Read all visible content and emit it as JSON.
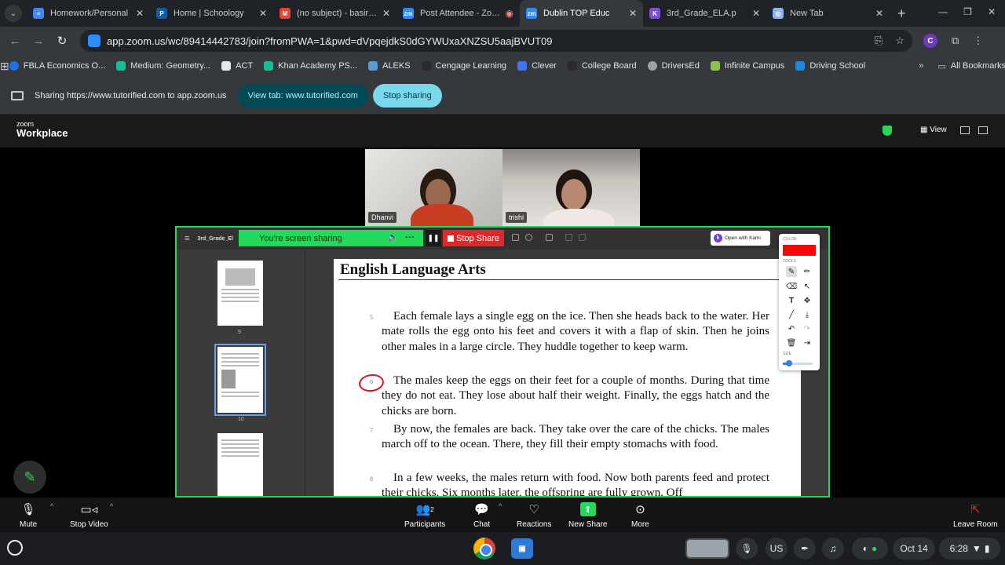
{
  "browser": {
    "tabs": [
      {
        "title": "Homework/Personal",
        "favicon_color": "#4285f4",
        "favicon_text": "≡"
      },
      {
        "title": "Home | Schoology",
        "favicon_color": "#0c5fa6",
        "favicon_text": "P"
      },
      {
        "title": "(no subject) - basired",
        "favicon_color": "#ea4335",
        "favicon_text": "M"
      },
      {
        "title": "Post Attendee - Zoom",
        "favicon_color": "#2d8cff",
        "favicon_text": "zm"
      },
      {
        "title": "Dublin TOP Educ",
        "favicon_color": "#2d8cff",
        "favicon_text": "zm",
        "active": true
      },
      {
        "title": "3rd_Grade_ELA.p",
        "favicon_color": "#7b4fd6",
        "favicon_text": "K"
      },
      {
        "title": "New Tab",
        "favicon_color": "#8ab4f8",
        "favicon_text": "◎"
      }
    ],
    "url": "app.zoom.us/wc/89414442783/join?fromPWA=1&pwd=dVpqejdkS0dGYWUxaXNZSU5aajBVUT09",
    "profile_initial": "C",
    "bookmarks": [
      {
        "label": "FBLA Economics O...",
        "color": "#1a73e8"
      },
      {
        "label": "Medium: Geometry...",
        "color": "#14bf96"
      },
      {
        "label": "ACT",
        "color": "#e8e8e8"
      },
      {
        "label": "Khan Academy PS...",
        "color": "#14bf96"
      },
      {
        "label": "ALEKS",
        "color": "#5b9bd5"
      },
      {
        "label": "Cengage Learning",
        "color": "#2b2b2b"
      },
      {
        "label": "Clever",
        "color": "#4274f6"
      },
      {
        "label": "College Board",
        "color": "#2b2b2b"
      },
      {
        "label": "DriversEd",
        "color": "#9aa0a6"
      },
      {
        "label": "Infinite Campus",
        "color": "#8bc34a"
      },
      {
        "label": "Driving School",
        "color": "#1e88e5"
      }
    ],
    "bookmarks_more": "»",
    "all_bookmarks": "All Bookmarks"
  },
  "sharebar": {
    "message": "Sharing https://www.tutorified.com to app.zoom.us",
    "view_tab_label": "View tab: www.tutorified.com",
    "stop_label": "Stop sharing"
  },
  "zoom": {
    "brand_top": "zoom",
    "brand_bottom": "Workplace",
    "view_label": "View",
    "participants_videos": [
      {
        "name": "Dhanvi"
      },
      {
        "name": "trishi"
      }
    ],
    "share": {
      "file_name": "3rd_Grade_El",
      "status": "You're screen sharing",
      "stop_label": "Stop Share",
      "kami_label": "Open with Kami",
      "thumb_pages": [
        "9",
        "10"
      ],
      "doc_title": "English Language Arts",
      "paragraphs": [
        {
          "num": "5",
          "text": "Each female lays a single egg on the ice. Then she heads back to the water. Her mate rolls the egg onto his feet and covers it with a flap of skin. Then he joins other males in a large circle. They huddle together to keep warm."
        },
        {
          "num": "6",
          "text": "The males keep the eggs on their feet for a couple of months. During that time they do not eat. They lose about half their weight. Finally, the eggs hatch and the chicks are born."
        },
        {
          "num": "7",
          "text": "By now, the females are back. They take over the care of the chicks. The males march off to the ocean. There, they fill their empty stomachs with food."
        },
        {
          "num": "8",
          "text": "In a few weeks, the males return with food. Now both parents feed and protect their chicks. Six months later, the offspring are fully grown. Off"
        }
      ],
      "kami_panel": {
        "color_label": "COLOR",
        "tools_label": "TOOLS",
        "size_label": "SIZE",
        "pen_color": "#f40808",
        "size_level": 0.2
      }
    },
    "toolbar": {
      "mute": "Mute",
      "stop_video": "Stop Video",
      "participants": "Participants",
      "participants_count": "2",
      "chat": "Chat",
      "reactions": "Reactions",
      "new_share": "New Share",
      "more": "More",
      "leave": "Leave Room"
    }
  },
  "shelf": {
    "ime": "US",
    "date": "Oct 14",
    "time": "6:28"
  }
}
